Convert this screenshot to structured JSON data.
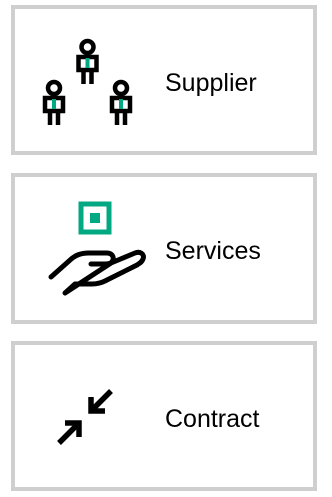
{
  "colors": {
    "border": "#cfcfcf",
    "icon_stroke": "#000000",
    "accent": "#01a982"
  },
  "cards": [
    {
      "label": "Supplier",
      "icon": "people-network-icon"
    },
    {
      "label": "Services",
      "icon": "hand-service-icon"
    },
    {
      "label": "Contract",
      "icon": "collapse-arrows-icon"
    }
  ]
}
